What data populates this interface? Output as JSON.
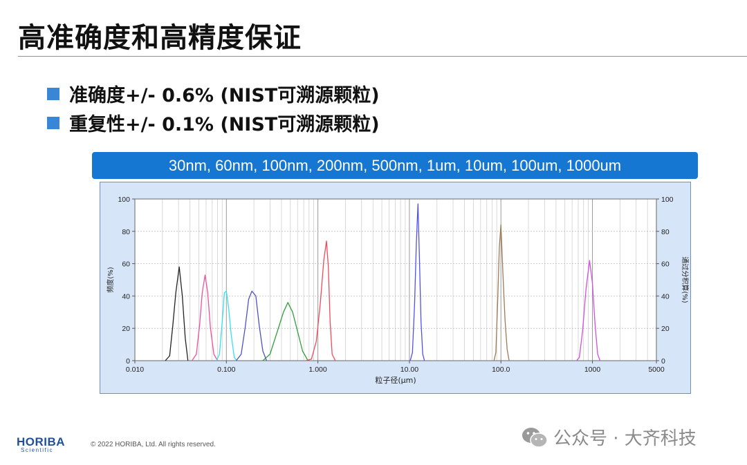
{
  "slide": {
    "title": "高准确度和高精度保证",
    "bullets": [
      "准确度+/- 0.6% (NIST可溯源颗粒)",
      "重复性+/- 0.1% (NIST可溯源颗粒)"
    ],
    "banner": "30nm,  60nm,  100nm,  200nm,  500nm,  1um,  10um,  100um,  1000um",
    "footer": {
      "logo": "HORIBA",
      "logo_sub": "Scientific",
      "copyright": "© 2022 HORIBA, Ltd. All rights reserved."
    },
    "watermark": {
      "text": "公众号 · 大齐科技",
      "icon": "wechat-icon"
    }
  },
  "chart_data": {
    "type": "line",
    "x_scale": "log",
    "xlim": [
      0.01,
      5000
    ],
    "ylim": [
      0,
      100
    ],
    "xlabel": "粒子径(μm)",
    "ylabel": "频度(%)",
    "y2label": "通过分积算(%)",
    "x_ticks": [
      "0.010",
      "0.100",
      "1.000",
      "10.00",
      "100.0",
      "1000",
      "5000"
    ],
    "y_ticks": [
      "0",
      "20",
      "40",
      "60",
      "80",
      "100"
    ],
    "y2_ticks": [
      "0",
      "20",
      "40",
      "60",
      "80",
      "100"
    ],
    "grid": true,
    "series": [
      {
        "color": "#222222",
        "points": [
          [
            0.0215,
            0
          ],
          [
            0.024,
            3
          ],
          [
            0.026,
            22
          ],
          [
            0.028,
            42
          ],
          [
            0.0305,
            58
          ],
          [
            0.033,
            40
          ],
          [
            0.0355,
            14
          ],
          [
            0.038,
            0
          ]
        ]
      },
      {
        "color": "#f0509a",
        "points": [
          [
            0.042,
            0
          ],
          [
            0.047,
            4
          ],
          [
            0.051,
            22
          ],
          [
            0.0545,
            42
          ],
          [
            0.0585,
            53
          ],
          [
            0.0625,
            42
          ],
          [
            0.067,
            20
          ],
          [
            0.073,
            4
          ],
          [
            0.08,
            0
          ]
        ]
      },
      {
        "color": "#33e0f0",
        "points": [
          [
            0.078,
            0
          ],
          [
            0.084,
            4
          ],
          [
            0.09,
            24
          ],
          [
            0.095,
            42
          ],
          [
            0.1,
            43
          ],
          [
            0.106,
            32
          ],
          [
            0.113,
            16
          ],
          [
            0.122,
            2
          ],
          [
            0.13,
            0
          ]
        ]
      },
      {
        "color": "#4b52c8",
        "points": [
          [
            0.128,
            0
          ],
          [
            0.145,
            4
          ],
          [
            0.16,
            20
          ],
          [
            0.175,
            38
          ],
          [
            0.19,
            43
          ],
          [
            0.21,
            40
          ],
          [
            0.228,
            22
          ],
          [
            0.25,
            6
          ],
          [
            0.275,
            0
          ]
        ]
      },
      {
        "color": "#2e9e3a",
        "points": [
          [
            0.25,
            0
          ],
          [
            0.3,
            4
          ],
          [
            0.36,
            18
          ],
          [
            0.42,
            30
          ],
          [
            0.47,
            36
          ],
          [
            0.53,
            30
          ],
          [
            0.6,
            18
          ],
          [
            0.68,
            6
          ],
          [
            0.78,
            0
          ]
        ]
      },
      {
        "color": "#f04a5a",
        "points": [
          [
            0.74,
            0
          ],
          [
            0.85,
            1
          ],
          [
            0.96,
            12
          ],
          [
            1.06,
            35
          ],
          [
            1.16,
            62
          ],
          [
            1.24,
            74
          ],
          [
            1.3,
            58
          ],
          [
            1.36,
            24
          ],
          [
            1.43,
            4
          ],
          [
            1.55,
            0
          ]
        ]
      },
      {
        "color": "#5050f0",
        "points": [
          [
            10.2,
            0
          ],
          [
            10.8,
            5
          ],
          [
            11.4,
            35
          ],
          [
            11.9,
            72
          ],
          [
            12.4,
            97
          ],
          [
            12.9,
            62
          ],
          [
            13.4,
            24
          ],
          [
            14.0,
            4
          ],
          [
            14.6,
            0
          ]
        ]
      },
      {
        "color": "#9c7a55",
        "points": [
          [
            84,
            0
          ],
          [
            88,
            5
          ],
          [
            92,
            35
          ],
          [
            96,
            70
          ],
          [
            100,
            84
          ],
          [
            105,
            55
          ],
          [
            111,
            25
          ],
          [
            117,
            7
          ],
          [
            123,
            0
          ]
        ]
      },
      {
        "color": "#d04ee0",
        "points": [
          [
            670,
            0
          ],
          [
            720,
            2
          ],
          [
            780,
            18
          ],
          [
            850,
            44
          ],
          [
            930,
            62
          ],
          [
            1000,
            48
          ],
          [
            1070,
            22
          ],
          [
            1140,
            4
          ],
          [
            1210,
            0
          ]
        ]
      }
    ]
  }
}
